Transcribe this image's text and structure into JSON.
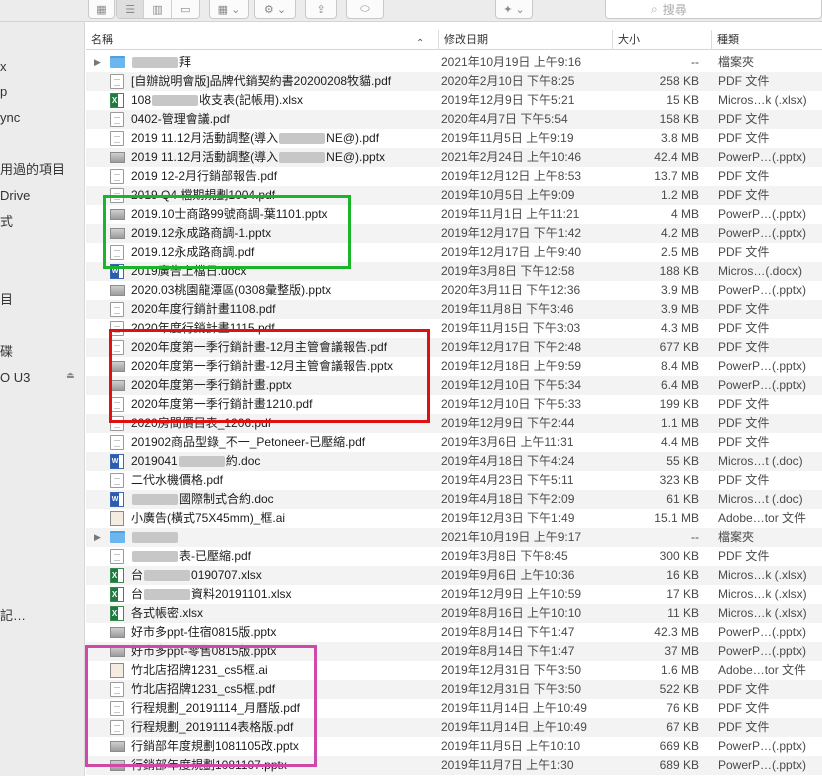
{
  "toolbar": {
    "search_placeholder": "搜尋",
    "search_icon": "magnifier-icon",
    "back_glyph": "‹",
    "forward_glyph": "›",
    "view_icons_glyph": "▦",
    "view_list_glyph": "☰",
    "view_columns_glyph": "▥",
    "view_gallery_glyph": "▭",
    "group_glyph": "▦ ⌄",
    "action_glyph": "⚙ ⌄",
    "share_glyph": "⇪",
    "tag_glyph": "⬭",
    "dropbox_glyph": "✦ ⌄"
  },
  "sidebar": {
    "items": [
      {
        "label": "x"
      },
      {
        "label": "p"
      },
      {
        "label": "ync"
      },
      {
        "label": "用過的項目"
      },
      {
        "label": "Drive"
      },
      {
        "label": "式"
      },
      {
        "label": "目"
      },
      {
        "label": "碟"
      },
      {
        "label": "O U3"
      },
      {
        "label": "記…"
      }
    ],
    "eject_glyph": "⏏"
  },
  "columns": {
    "name": "名稱",
    "date": "修改日期",
    "size": "大小",
    "kind": "種類",
    "sort_arrow": "⌃"
  },
  "rows": [
    {
      "icon": "folder",
      "disclosure": "▶",
      "name_pre": "",
      "name_blur": true,
      "name_post": "拜",
      "date": "2021年10月19日 上午9:16",
      "size": "--",
      "kind": "檔案夾"
    },
    {
      "icon": "pdf",
      "name_pre": "[自辦說明會版]品牌代銷契約書20200208牧貓.pdf",
      "date": "2020年2月10日 下午8:25",
      "size": "258 KB",
      "kind": "PDF 文件"
    },
    {
      "icon": "xls",
      "name_pre": "108",
      "name_blur": true,
      "name_post": "收支表(記帳用).xlsx",
      "date": "2019年12月9日 下午5:21",
      "size": "15 KB",
      "kind": "Micros…k (.xlsx)"
    },
    {
      "icon": "pdf",
      "name_pre": "0402-管理會議.pdf",
      "date": "2020年4月7日 下午5:54",
      "size": "158 KB",
      "kind": "PDF 文件"
    },
    {
      "icon": "pdf",
      "name_pre": "2019 11.12月活動調整(導入",
      "name_blur": true,
      "name_post": "NE@).pdf",
      "date": "2019年11月5日 上午9:19",
      "size": "3.8 MB",
      "kind": "PDF 文件"
    },
    {
      "icon": "ppt",
      "name_pre": "2019 11.12月活動調整(導入",
      "name_blur": true,
      "name_post": "NE@).pptx",
      "date": "2021年2月24日 上午10:46",
      "size": "42.4 MB",
      "kind": "PowerP…(.pptx)"
    },
    {
      "icon": "pdf",
      "name_pre": "2019 12-2月行銷部報告.pdf",
      "date": "2019年12月12日 上午8:53",
      "size": "13.7 MB",
      "kind": "PDF 文件"
    },
    {
      "icon": "pdf",
      "name_pre": "2019 Q4 檔期規劃1004.pdf",
      "date": "2019年10月5日 上午9:09",
      "size": "1.2 MB",
      "kind": "PDF 文件"
    },
    {
      "icon": "ppt",
      "name_pre": "2019.10士商路99號商調-葉1101.pptx",
      "date": "2019年11月1日 上午11:21",
      "size": "4 MB",
      "kind": "PowerP…(.pptx)"
    },
    {
      "icon": "ppt",
      "name_pre": "2019.12永成路商調-1.pptx",
      "date": "2019年12月17日 下午1:42",
      "size": "4.2 MB",
      "kind": "PowerP…(.pptx)"
    },
    {
      "icon": "pdf",
      "name_pre": "2019.12永成路商調.pdf",
      "date": "2019年12月17日 上午9:40",
      "size": "2.5 MB",
      "kind": "PDF 文件"
    },
    {
      "icon": "doc",
      "name_pre": "2019廣告上檔日.docx",
      "date": "2019年3月8日 下午12:58",
      "size": "188 KB",
      "kind": "Micros…(.docx)"
    },
    {
      "icon": "ppt",
      "name_pre": "2020.03桃園龍潭區(0308彙整版).pptx",
      "date": "2020年3月11日 下午12:36",
      "size": "3.9 MB",
      "kind": "PowerP…(.pptx)"
    },
    {
      "icon": "pdf",
      "name_pre": "2020年度行銷計畫1108.pdf",
      "date": "2019年11月8日 下午3:46",
      "size": "3.9 MB",
      "kind": "PDF 文件"
    },
    {
      "icon": "pdf",
      "name_pre": "2020年度行銷計畫1115.pdf",
      "date": "2019年11月15日 下午3:03",
      "size": "4.3 MB",
      "kind": "PDF 文件"
    },
    {
      "icon": "pdf",
      "name_pre": "2020年度第一季行銷計畫-12月主管會議報告.pdf",
      "date": "2019年12月17日 下午2:48",
      "size": "677 KB",
      "kind": "PDF 文件"
    },
    {
      "icon": "ppt",
      "name_pre": "2020年度第一季行銷計畫-12月主管會議報告.pptx",
      "date": "2019年12月18日 上午9:59",
      "size": "8.4 MB",
      "kind": "PowerP…(.pptx)"
    },
    {
      "icon": "ppt",
      "name_pre": "2020年度第一季行銷計畫.pptx",
      "date": "2019年12月10日 下午5:34",
      "size": "6.4 MB",
      "kind": "PowerP…(.pptx)"
    },
    {
      "icon": "pdf",
      "name_pre": "2020年度第一季行銷計畫1210.pdf",
      "date": "2019年12月10日 下午5:33",
      "size": "199 KB",
      "kind": "PDF 文件"
    },
    {
      "icon": "pdf",
      "name_pre": "2020房間價目表_1206.pdf",
      "date": "2019年12月9日 下午2:44",
      "size": "1.1 MB",
      "kind": "PDF 文件"
    },
    {
      "icon": "pdf",
      "name_pre": "201902商品型錄_不一_Petoneer-已壓縮.pdf",
      "date": "2019年3月6日 上午11:31",
      "size": "4.4 MB",
      "kind": "PDF 文件"
    },
    {
      "icon": "doc",
      "name_pre": "2019041",
      "name_blur": true,
      "name_post": "約.doc",
      "date": "2019年4月18日 下午4:24",
      "size": "55 KB",
      "kind": "Micros…t (.doc)"
    },
    {
      "icon": "pdf",
      "name_pre": "二代水機價格.pdf",
      "date": "2019年4月23日 下午5:11",
      "size": "323 KB",
      "kind": "PDF 文件"
    },
    {
      "icon": "doc",
      "name_pre": "",
      "name_blur": true,
      "name_post": "國際制式合約.doc",
      "date": "2019年4月18日 下午2:09",
      "size": "61 KB",
      "kind": "Micros…t (.doc)"
    },
    {
      "icon": "ai",
      "name_pre": "小廣告(橫式75X45mm)_框.ai",
      "date": "2019年12月3日 下午1:49",
      "size": "15.1 MB",
      "kind": "Adobe…tor 文件"
    },
    {
      "icon": "folder",
      "disclosure": "▶",
      "name_pre": "",
      "name_blur": true,
      "name_post": "",
      "date": "2021年10月19日 上午9:17",
      "size": "--",
      "kind": "檔案夾"
    },
    {
      "icon": "pdf",
      "name_pre": "",
      "name_blur": true,
      "name_post": "表-已壓縮.pdf",
      "date": "2019年3月8日 下午8:45",
      "size": "300 KB",
      "kind": "PDF 文件"
    },
    {
      "icon": "xls",
      "name_pre": "台",
      "name_blur": true,
      "name_post": "0190707.xlsx",
      "date": "2019年9月6日 上午10:36",
      "size": "16 KB",
      "kind": "Micros…k (.xlsx)"
    },
    {
      "icon": "xls",
      "name_pre": "台",
      "name_blur": true,
      "name_post": "資料20191101.xlsx",
      "date": "2019年12月9日 上午10:59",
      "size": "17 KB",
      "kind": "Micros…k (.xlsx)"
    },
    {
      "icon": "xls",
      "name_pre": "各式帳密.xlsx",
      "date": "2019年8月16日 上午10:10",
      "size": "11 KB",
      "kind": "Micros…k (.xlsx)"
    },
    {
      "icon": "ppt",
      "name_pre": "好市多ppt-住宿0815版.pptx",
      "date": "2019年8月14日 下午1:47",
      "size": "42.3 MB",
      "kind": "PowerP…(.pptx)"
    },
    {
      "icon": "ppt",
      "name_pre": "好市多ppt-零售0815版.pptx",
      "date": "2019年8月14日 下午1:47",
      "size": "37 MB",
      "kind": "PowerP…(.pptx)"
    },
    {
      "icon": "ai",
      "name_pre": "竹北店招牌1231_cs5框.ai",
      "date": "2019年12月31日 下午3:50",
      "size": "1.6 MB",
      "kind": "Adobe…tor 文件"
    },
    {
      "icon": "pdf",
      "name_pre": "竹北店招牌1231_cs5框.pdf",
      "date": "2019年12月31日 下午3:50",
      "size": "522 KB",
      "kind": "PDF 文件"
    },
    {
      "icon": "pdf",
      "name_pre": "行程規劃_20191114_月曆版.pdf",
      "date": "2019年11月14日 上午10:49",
      "size": "76 KB",
      "kind": "PDF 文件"
    },
    {
      "icon": "pdf",
      "name_pre": "行程規劃_20191114表格版.pdf",
      "date": "2019年11月14日 上午10:49",
      "size": "67 KB",
      "kind": "PDF 文件"
    },
    {
      "icon": "ppt",
      "name_pre": "行銷部年度規劃1081105改.pptx",
      "date": "2019年11月5日 上午10:10",
      "size": "669 KB",
      "kind": "PowerP…(.pptx)"
    },
    {
      "icon": "ppt",
      "name_pre": "行銷部年度規劃1081107.pptx",
      "date": "2019年11月7日 上午1:30",
      "size": "689 KB",
      "kind": "PowerP…(.pptx)"
    }
  ],
  "highlight_colors": {
    "green": "#1bb52a",
    "red": "#e01010",
    "magenta": "#d048a8"
  }
}
